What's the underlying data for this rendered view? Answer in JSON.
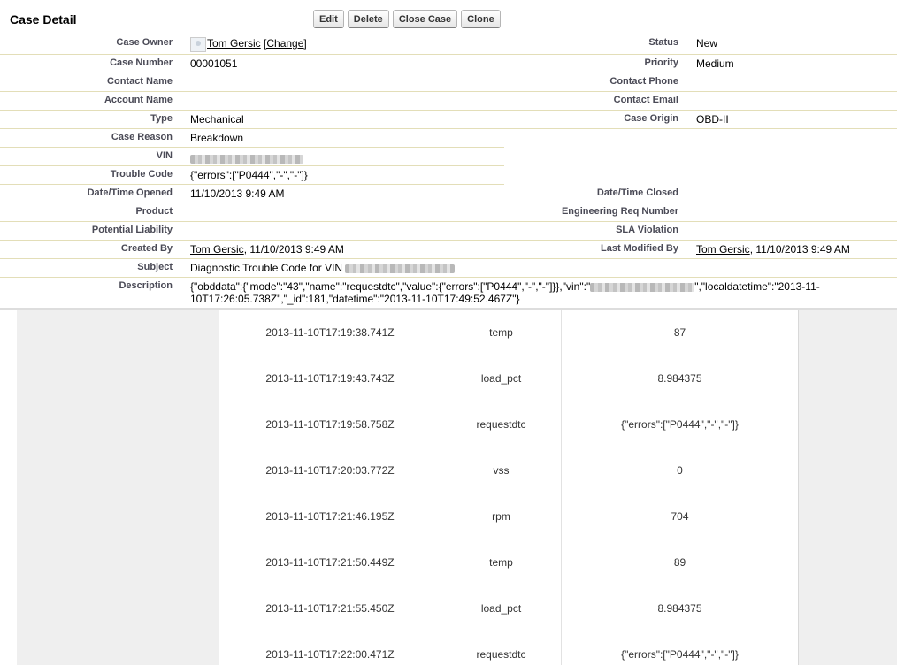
{
  "header": {
    "title": "Case Detail",
    "buttons": [
      "Edit",
      "Delete",
      "Close Case",
      "Clone"
    ]
  },
  "fields": {
    "case_owner": {
      "label": "Case Owner",
      "name": "Tom Gersic",
      "change": "[Change]"
    },
    "status": {
      "label": "Status",
      "value": "New"
    },
    "case_number": {
      "label": "Case Number",
      "value": "00001051"
    },
    "priority": {
      "label": "Priority",
      "value": "Medium"
    },
    "contact_name": {
      "label": "Contact Name",
      "value": ""
    },
    "contact_phone": {
      "label": "Contact Phone",
      "value": ""
    },
    "account_name": {
      "label": "Account Name",
      "value": ""
    },
    "contact_email": {
      "label": "Contact Email",
      "value": ""
    },
    "type": {
      "label": "Type",
      "value": "Mechanical"
    },
    "case_origin": {
      "label": "Case Origin",
      "value": "OBD-II"
    },
    "case_reason": {
      "label": "Case Reason",
      "value": "Breakdown"
    },
    "vin": {
      "label": "VIN"
    },
    "trouble_code": {
      "label": "Trouble Code",
      "value": "{\"errors\":[\"P0444\",\"-\",\"-\"]}"
    },
    "date_opened": {
      "label": "Date/Time Opened",
      "value": "11/10/2013 9:49 AM"
    },
    "date_closed": {
      "label": "Date/Time Closed",
      "value": ""
    },
    "product": {
      "label": "Product",
      "value": ""
    },
    "eng_req": {
      "label": "Engineering Req Number",
      "value": ""
    },
    "potential_liability": {
      "label": "Potential Liability",
      "value": ""
    },
    "sla_violation": {
      "label": "SLA Violation",
      "value": ""
    },
    "created_by": {
      "label": "Created By",
      "name": "Tom Gersic",
      "date": ", 11/10/2013 9:49 AM"
    },
    "last_modified_by": {
      "label": "Last Modified By",
      "name": "Tom Gersic",
      "date": ", 11/10/2013 9:49 AM"
    },
    "subject": {
      "label": "Subject",
      "value": "Diagnostic Trouble Code for VIN"
    },
    "description": {
      "label": "Description",
      "part1": "{\"obddata\":{\"mode\":\"43\",\"name\":\"requestdtc\",\"value\":{\"errors\":[\"P0444\",\"-\",\"-\"]}},\"vin\":\"",
      "part2": "\",\"localdatetime\":\"2013-11-10T17:26:05.738Z\",\"_id\":181,\"datetime\":\"2013-11-10T17:49:52.467Z\"}"
    }
  },
  "obd_table": [
    {
      "time": "2013-11-10T17:19:38.741Z",
      "name": "temp",
      "value": "87"
    },
    {
      "time": "2013-11-10T17:19:43.743Z",
      "name": "load_pct",
      "value": "8.984375"
    },
    {
      "time": "2013-11-10T17:19:58.758Z",
      "name": "requestdtc",
      "value": "{\"errors\":[\"P0444\",\"-\",\"-\"]}"
    },
    {
      "time": "2013-11-10T17:20:03.772Z",
      "name": "vss",
      "value": "0"
    },
    {
      "time": "2013-11-10T17:21:46.195Z",
      "name": "rpm",
      "value": "704"
    },
    {
      "time": "2013-11-10T17:21:50.449Z",
      "name": "temp",
      "value": "89"
    },
    {
      "time": "2013-11-10T17:21:55.450Z",
      "name": "load_pct",
      "value": "8.984375"
    },
    {
      "time": "2013-11-10T17:22:00.471Z",
      "name": "requestdtc",
      "value": "{\"errors\":[\"P0444\",\"-\",\"-\"]}"
    }
  ]
}
